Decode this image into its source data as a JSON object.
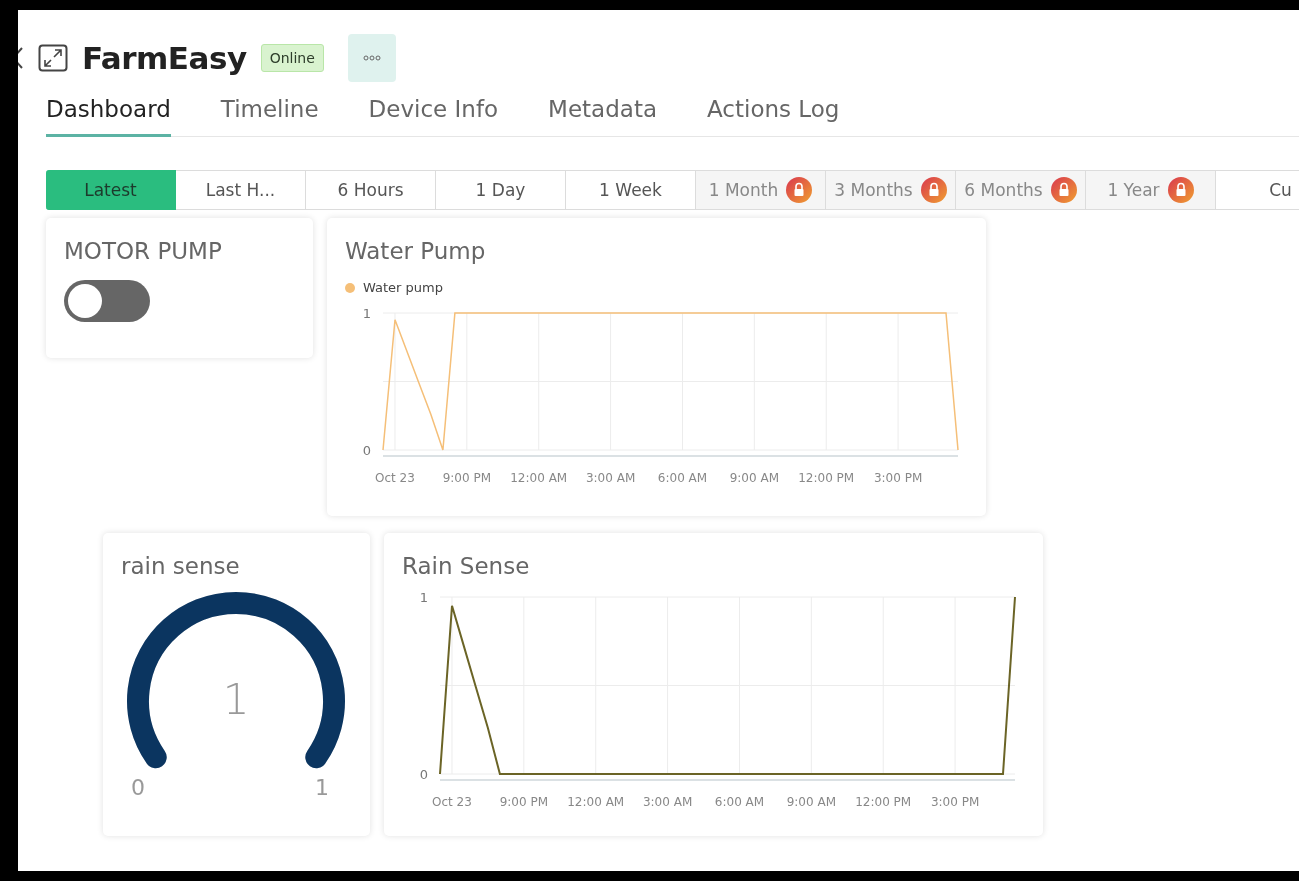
{
  "header": {
    "title": "FarmEasy",
    "status": "Online"
  },
  "tabs": [
    {
      "label": "Dashboard",
      "selected": true
    },
    {
      "label": "Timeline",
      "selected": false
    },
    {
      "label": "Device Info",
      "selected": false
    },
    {
      "label": "Metadata",
      "selected": false
    },
    {
      "label": "Actions Log",
      "selected": false
    }
  ],
  "time_ranges": [
    {
      "label": "Latest",
      "selected": true,
      "locked": false
    },
    {
      "label": "Last H...",
      "selected": false,
      "locked": false
    },
    {
      "label": "6 Hours",
      "selected": false,
      "locked": false
    },
    {
      "label": "1 Day",
      "selected": false,
      "locked": false
    },
    {
      "label": "1 Week",
      "selected": false,
      "locked": false
    },
    {
      "label": "1 Month",
      "selected": false,
      "locked": true
    },
    {
      "label": "3 Months",
      "selected": false,
      "locked": true
    },
    {
      "label": "6 Months",
      "selected": false,
      "locked": true
    },
    {
      "label": "1 Year",
      "selected": false,
      "locked": true
    },
    {
      "label": "Cu",
      "selected": false,
      "locked": false
    }
  ],
  "widgets": {
    "switch": {
      "title": "MOTOR PUMP",
      "on": false
    },
    "water_chart": {
      "title": "Water Pump",
      "chart_data": {
        "type": "line",
        "grid": true,
        "categories": [
          null,
          "Oct 23",
          null,
          null,
          null,
          null,
          null,
          "9:00 PM",
          null,
          null,
          null,
          null,
          null,
          "12:00 AM",
          null,
          null,
          null,
          null,
          null,
          "3:00 AM",
          null,
          null,
          null,
          null,
          null,
          "6:00 AM",
          null,
          null,
          null,
          null,
          null,
          "9:00 AM",
          null,
          null,
          null,
          null,
          null,
          "12:00 PM",
          null,
          null,
          null,
          null,
          null,
          "3:00 PM",
          null,
          null,
          null,
          null,
          null
        ],
        "series": [
          {
            "name": "Water pump",
            "color": "#f5bf78",
            "values": [
              0,
              0.95,
              0.72,
              0.49,
              0.26,
              0,
              1,
              1,
              1,
              1,
              1,
              1,
              1,
              1,
              1,
              1,
              1,
              1,
              1,
              1,
              1,
              1,
              1,
              1,
              1,
              1,
              1,
              1,
              1,
              1,
              1,
              1,
              1,
              1,
              1,
              1,
              1,
              1,
              1,
              1,
              1,
              1,
              1,
              1,
              1,
              1,
              1,
              1,
              0
            ]
          }
        ],
        "ylim": [
          0,
          1
        ],
        "yticks": [
          0,
          1
        ]
      }
    },
    "gauge": {
      "title": "rain sense",
      "value": "1",
      "min": "0",
      "max": "1",
      "level": 1
    },
    "rain_chart": {
      "title": "Rain Sense",
      "chart_data": {
        "type": "line",
        "grid": true,
        "categories": [
          null,
          "Oct 23",
          null,
          null,
          null,
          null,
          null,
          "9:00 PM",
          null,
          null,
          null,
          null,
          null,
          "12:00 AM",
          null,
          null,
          null,
          null,
          null,
          "3:00 AM",
          null,
          null,
          null,
          null,
          null,
          "6:00 AM",
          null,
          null,
          null,
          null,
          null,
          "9:00 AM",
          null,
          null,
          null,
          null,
          null,
          "12:00 PM",
          null,
          null,
          null,
          null,
          null,
          "3:00 PM",
          null,
          null,
          null,
          null,
          null
        ],
        "series": [
          {
            "color": "#6b6426",
            "values": [
              0,
              0.95,
              0.72,
              0.49,
              0.26,
              0,
              0,
              0,
              0,
              0,
              0,
              0,
              0,
              0,
              0,
              0,
              0,
              0,
              0,
              0,
              0,
              0,
              0,
              0,
              0,
              0,
              0,
              0,
              0,
              0,
              0,
              0,
              0,
              0,
              0,
              0,
              0,
              0,
              0,
              0,
              0,
              0,
              0,
              0,
              0,
              0,
              0,
              0,
              1
            ]
          }
        ],
        "ylim": [
          0,
          1
        ],
        "yticks": [
          0,
          1
        ]
      }
    }
  }
}
